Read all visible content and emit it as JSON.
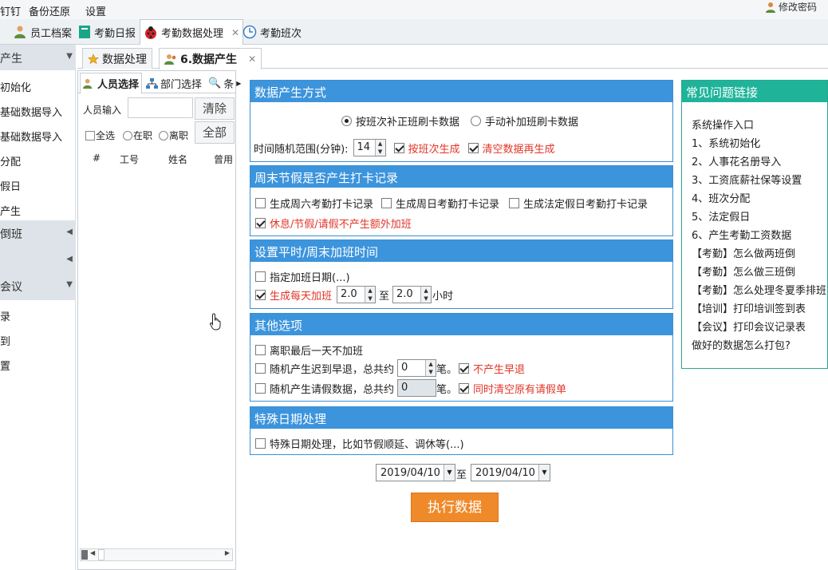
{
  "menubar": {
    "items": [
      "钉钉",
      "备份还原",
      "设置"
    ],
    "change_password": "修改密码"
  },
  "app_tabs": [
    {
      "label": "员工档案"
    },
    {
      "label": "考勤日报"
    },
    {
      "label": "考勤数据处理"
    },
    {
      "label": "考勤班次"
    }
  ],
  "left_nav": {
    "section1": "产生",
    "items1": [
      "初始化",
      "基础数据导入",
      "基础数据导入",
      "分配",
      "假日",
      "产生"
    ],
    "sub1": "倒班",
    "section2": "会议",
    "items2": [
      "录",
      "到",
      "置"
    ]
  },
  "content_tabs": [
    {
      "label": "数据处理"
    },
    {
      "label": "6.数据产生"
    }
  ],
  "selector": {
    "tabs": [
      "人员选择",
      "部门选择",
      "条"
    ],
    "input_label": "人员输入",
    "input_value": "",
    "clear_button": "清除",
    "all_button": "全部",
    "filters": [
      "全选",
      "在职",
      "离职"
    ],
    "columns": [
      "#",
      "工号",
      "姓名",
      "曾用"
    ]
  },
  "method": {
    "title": "数据产生方式",
    "option1": "按班次补正班刷卡数据",
    "option2": "手动补加班刷卡数据",
    "range_label": "时间随机范围(分钟):",
    "range_value": "14",
    "by_shift": "按班次生成",
    "clear_regen": "清空数据再生成"
  },
  "weekend": {
    "title": "周末节假是否产生打卡记录",
    "sat": "生成周六考勤打卡记录",
    "sun": "生成周日考勤打卡记录",
    "holiday": "生成法定假日考勤打卡记录",
    "no_extra": "休息/节假/请假不产生额外加班"
  },
  "overtime": {
    "title": "设置平时/周末加班时间",
    "specify": "指定加班日期(...)",
    "daily": "生成每天加班",
    "from": "2.0",
    "to_label": "至",
    "to": "2.0",
    "unit": "小时"
  },
  "other": {
    "title": "其他选项",
    "no_last_day": "离职最后一天不加班",
    "late_label": "随机产生迟到早退，总共约",
    "late_value": "0",
    "count_unit": "笔。",
    "no_early": "不产生早退",
    "leave_label": "随机产生请假数据，总共约",
    "leave_value": "0",
    "clear_leave": "同时清空原有请假单"
  },
  "special": {
    "title": "特殊日期处理",
    "desc": "特殊日期处理，比如节假顺延、调休等(...)"
  },
  "date_range": {
    "from": "2019/04/10",
    "to_label": "至",
    "to": "2019/04/10"
  },
  "execute": "执行数据",
  "faq": {
    "title": "常见问题链接",
    "items": [
      "系统操作入口",
      "1、系统初始化",
      "2、人事花名册导入",
      "3、工资底薪社保等设置",
      "4、班次分配",
      "5、法定假日",
      "6、产生考勤工资数据",
      "【考勤】怎么做两班倒",
      "【考勤】怎么做三班倒",
      "【考勤】怎么处理冬夏季排班",
      "【培训】打印培训签到表",
      "【会议】打印会议记录表",
      "做好的数据怎么打包?"
    ]
  },
  "colors": {
    "section_blue": "#3c94dc",
    "faq_green": "#1fb39a",
    "execute_orange": "#ef8a2b",
    "warn_red": "#e0362a"
  }
}
